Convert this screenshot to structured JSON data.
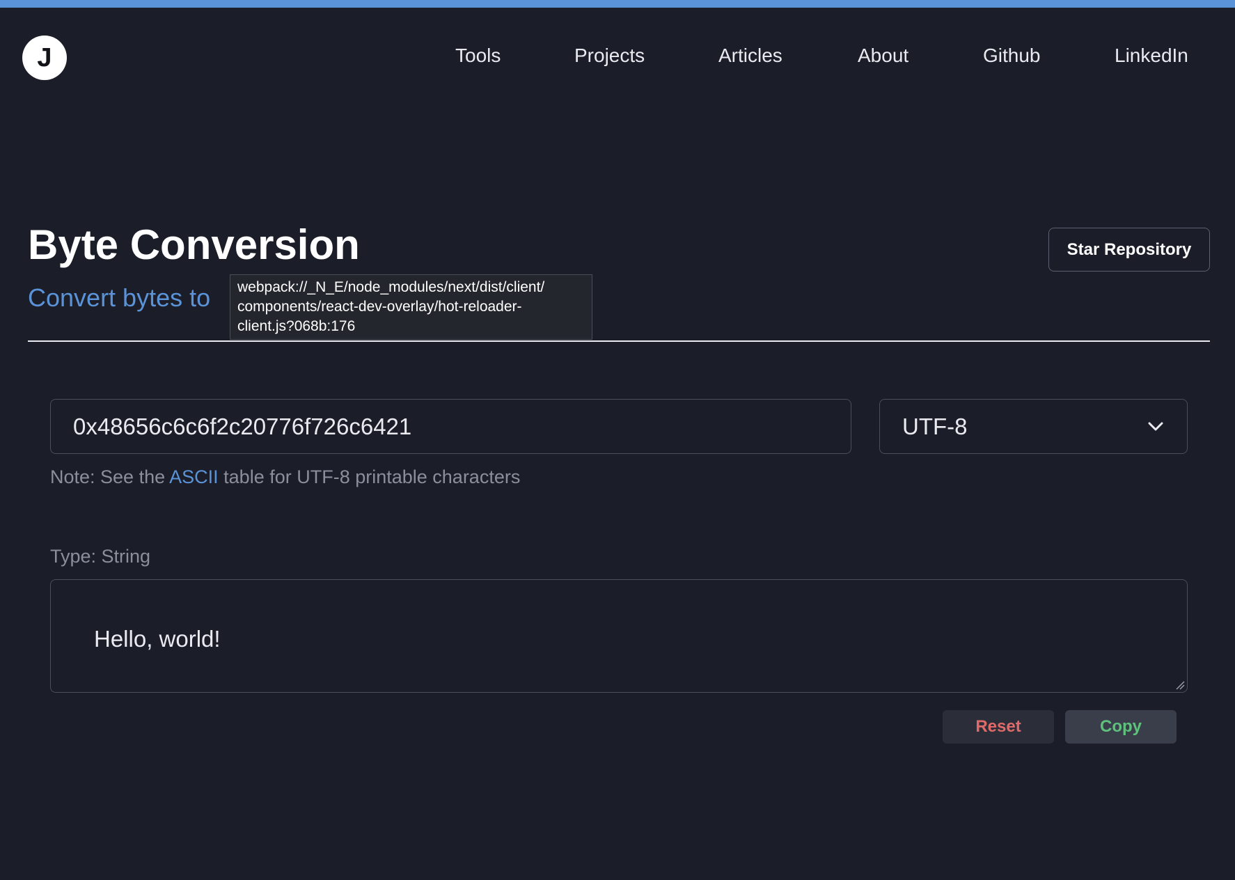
{
  "window": {
    "accent_bar_color": "#5b93d9"
  },
  "header": {
    "logo_letter": "J",
    "nav": [
      {
        "label": "Tools"
      },
      {
        "label": "Projects"
      },
      {
        "label": "Articles"
      },
      {
        "label": "About"
      },
      {
        "label": "Github"
      },
      {
        "label": "LinkedIn"
      }
    ]
  },
  "hero": {
    "title": "Byte Conversion",
    "subtitle": "Convert bytes to",
    "star_label": "Star Repository"
  },
  "tooltip": {
    "lines": [
      "webpack://_N_E/node_modules/next/dist/client/",
      "components/react-dev-overlay/hot-reloader-",
      "client.js?068b:176"
    ]
  },
  "converter": {
    "input_value": "0x48656c6c6f2c20776f726c6421",
    "encoding": "UTF-8",
    "note_prefix": "Note: See the ",
    "note_link": "ASCII",
    "note_suffix": " table for UTF-8 printable characters",
    "type_label": "Type: String",
    "output_value": "Hello, world!",
    "reset_label": "Reset",
    "copy_label": "Copy"
  },
  "colors": {
    "background": "#1b1d28",
    "accent": "#5b93d9",
    "reset": "#e06a6a",
    "copy": "#5ec27c"
  },
  "icons": {
    "encoding_dropdown": "chevron-down-icon",
    "resize": "resize-grip-icon"
  }
}
